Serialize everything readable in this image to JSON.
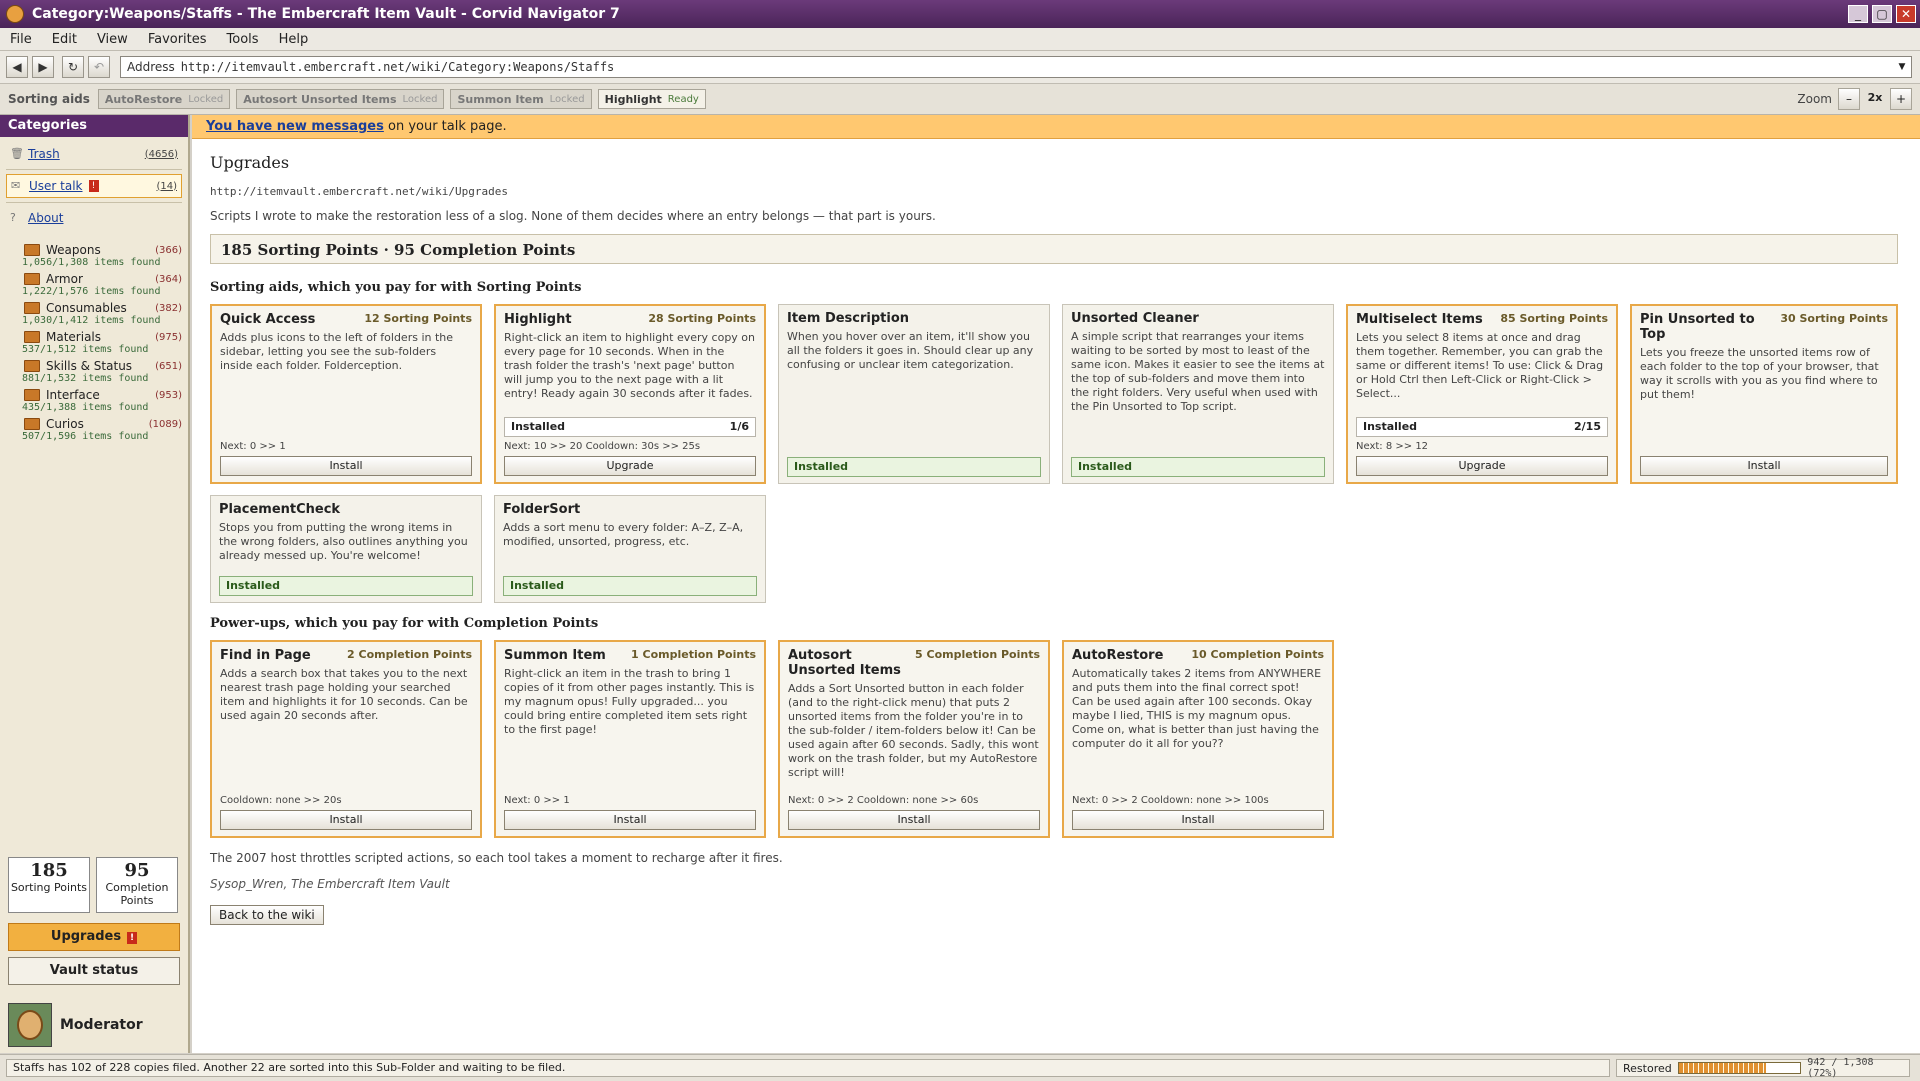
{
  "window": {
    "title": "Category:Weapons/Staffs - The Embercraft Item Vault - Corvid Navigator 7",
    "minimize": "_",
    "maximize": "▢",
    "close": "✕"
  },
  "menu": [
    "File",
    "Edit",
    "View",
    "Favorites",
    "Tools",
    "Help"
  ],
  "address": {
    "label": "Address",
    "url": "http://itemvault.embercraft.net/wiki/Category:Weapons/Staffs"
  },
  "toolbar": {
    "label": "Sorting aids",
    "buttons": [
      {
        "name": "AutoRestore",
        "state": "Locked"
      },
      {
        "name": "Autosort Unsorted Items",
        "state": "Locked"
      },
      {
        "name": "Summon Item",
        "state": "Locked"
      },
      {
        "name": "Highlight",
        "state": "Ready"
      }
    ],
    "zoom_label": "Zoom",
    "zoom_value": "2x"
  },
  "sidebar": {
    "title": "Categories",
    "trash": {
      "label": "Trash",
      "count": "(4656)"
    },
    "user_talk": {
      "label": "User talk",
      "badge": "!",
      "count": "(14)"
    },
    "about": {
      "label": "About"
    },
    "folders": [
      {
        "name": "Weapons",
        "count": "(366)",
        "found": "1,056/1,308 items found"
      },
      {
        "name": "Armor",
        "count": "(364)",
        "found": "1,222/1,576 items found"
      },
      {
        "name": "Consumables",
        "count": "(382)",
        "found": "1,030/1,412 items found"
      },
      {
        "name": "Materials",
        "count": "(975)",
        "found": "537/1,512 items found"
      },
      {
        "name": "Skills & Status",
        "count": "(651)",
        "found": "881/1,532 items found"
      },
      {
        "name": "Interface",
        "count": "(953)",
        "found": "435/1,388 items found"
      },
      {
        "name": "Curios",
        "count": "(1089)",
        "found": "507/1,596 items found"
      }
    ],
    "points": [
      {
        "value": "185",
        "label": "Sorting Points"
      },
      {
        "value": "95",
        "label": "Completion Points"
      }
    ],
    "upgrades_label": "Upgrades",
    "upgrades_badge": "!",
    "vault_status_label": "Vault status",
    "user": "Moderator"
  },
  "banner": {
    "link": "You have new messages",
    "text": " on your talk page."
  },
  "page": {
    "title": "Upgrades",
    "url": "http://itemvault.embercraft.net/wiki/Upgrades",
    "intro": "Scripts I wrote to make the restoration less of a slog. None of them decides where an entry belongs — that part is yours.",
    "points_banner": "185 Sorting Points · 95 Completion Points",
    "section1": "Sorting aids, which you pay for with Sorting Points",
    "section2": "Power-ups, which you pay for with Completion Points",
    "footnote": "The 2007 host throttles scripted actions, so each tool takes a moment to recharge after it fires.",
    "signature": "Sysop_Wren, The Embercraft Item Vault",
    "back": "Back to the wiki"
  },
  "cards": [
    {
      "title": "Quick Access",
      "cost": "12 Sorting Points",
      "desc": "Adds plus icons to the left of folders in the sidebar, letting you see the sub-folders inside each folder. Folderception.",
      "next": "Next: 0 >> 1",
      "action": "Install"
    },
    {
      "title": "Highlight",
      "cost": "28 Sorting Points",
      "desc": "Right-click an item to highlight every copy on every page for 10 seconds. When in the trash folder the trash's 'next page' button will jump you to the next page with a lit entry! Ready again 30 seconds after it fades.",
      "progress_label": "Installed",
      "progress_value": "1/6",
      "next": "Next: 10 >> 20 Cooldown: 30s >> 25s",
      "action": "Upgrade"
    },
    {
      "title": "Item Description",
      "desc": "When you hover over an item, it'll show you all the folders it goes in. Should clear up any confusing or unclear item categorization.",
      "installed": "Installed"
    },
    {
      "title": "Unsorted Cleaner",
      "desc": "A simple script that rearranges your items waiting to be sorted by most to least of the same icon. Makes it easier to see the items at the top of sub-folders and move them into the right folders. Very useful when used with the Pin Unsorted to Top script.",
      "installed": "Installed"
    },
    {
      "title": "Multiselect Items",
      "cost": "85 Sorting Points",
      "desc": "Lets you select 8 items at once and drag them together. Remember, you can grab the same or different items! To use: Click & Drag or Hold Ctrl then Left-Click or Right-Click > Select...",
      "progress_label": "Installed",
      "progress_value": "2/15",
      "next": "Next: 8 >> 12",
      "action": "Upgrade"
    },
    {
      "title": "Pin Unsorted to Top",
      "cost": "30 Sorting Points",
      "desc": "Lets you freeze the unsorted items row of each folder to the top of your browser, that way it scrolls with you as you find where to put them!",
      "action": "Install"
    },
    {
      "title": "PlacementCheck",
      "desc": "Stops you from putting the wrong items in the wrong folders, also outlines anything you already messed up. You're welcome!",
      "installed": "Installed"
    },
    {
      "title": "FolderSort",
      "desc": "Adds a sort menu to every folder: A–Z, Z–A, modified, unsorted, progress, etc.",
      "installed": "Installed"
    },
    {
      "title": "Find in Page",
      "cost": "2 Completion Points",
      "desc": "Adds a search box that takes you to the next nearest trash page holding your searched item and highlights it for 10 seconds. Can be used again 20 seconds after.",
      "next": "Cooldown: none >> 20s",
      "action": "Install"
    },
    {
      "title": "Summon Item",
      "cost": "1 Completion Points",
      "desc": "Right-click an item in the trash to bring 1 copies of it from other pages instantly. This is my magnum opus! Fully upgraded... you could bring entire completed item sets right to the first page!",
      "next": "Next: 0 >> 1",
      "action": "Install"
    },
    {
      "title": "Autosort Unsorted Items",
      "cost": "5 Completion Points",
      "desc": "Adds a Sort Unsorted button in each folder (and to the right-click menu) that puts 2 unsorted items from the folder you're in to the sub-folder / item-folders below it! Can be used again after 60 seconds. Sadly, this wont work on the trash folder, but my AutoRestore script will!",
      "next": "Next: 0 >> 2 Cooldown: none >> 60s",
      "action": "Install"
    },
    {
      "title": "AutoRestore",
      "cost": "10 Completion Points",
      "desc": "Automatically takes 2 items from ANYWHERE and puts them into the final correct spot! Can be used again after 100 seconds. Okay maybe I lied, THIS is my magnum opus. Come on, what is better than just having the computer do it all for you??",
      "next": "Next: 0 >> 2 Cooldown: none >> 100s",
      "action": "Install"
    }
  ],
  "status": {
    "message": "Staffs has 102 of 228 copies filed. Another 22 are sorted into this Sub-Folder and waiting to be filed.",
    "restored_label": "Restored",
    "restored_fraction": 0.72,
    "restored_text": "942 / 1,308 (72%)"
  }
}
